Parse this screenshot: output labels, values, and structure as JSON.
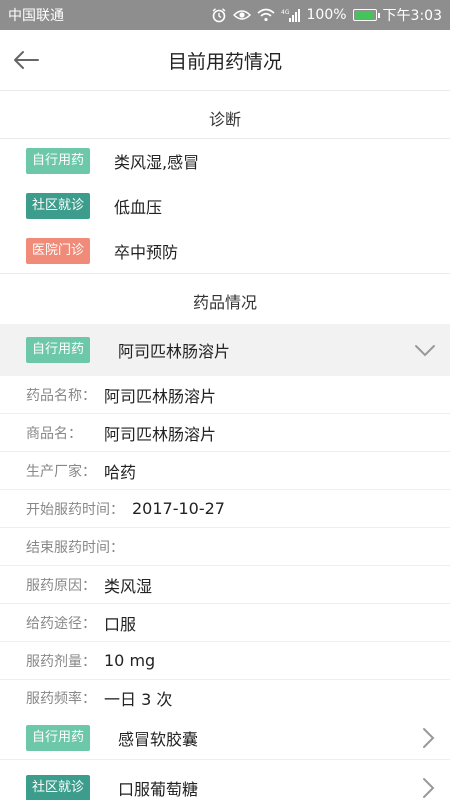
{
  "status_bar": {
    "carrier": "中国联通",
    "battery": "100%",
    "time": "下午3:03",
    "network": "4G",
    "battery_level": 1.0
  },
  "nav": {
    "title": "目前用药情况"
  },
  "diagnosis": {
    "title": "诊断",
    "items": [
      {
        "tag": "自行用药",
        "text": "类风湿,感冒"
      },
      {
        "tag": "社区就诊",
        "text": "低血压"
      },
      {
        "tag": "医院门诊",
        "text": "卒中预防"
      }
    ]
  },
  "drugs": {
    "title": "药品情况",
    "expanded": {
      "tag": "自行用药",
      "name": "阿司匹林肠溶片",
      "details": [
        {
          "label": "药品名称：",
          "value": "阿司匹林肠溶片"
        },
        {
          "label": "商品名：",
          "value": "阿司匹林肠溶片"
        },
        {
          "label": "生产厂家：",
          "value": "哈药"
        },
        {
          "label": "开始服药时间：",
          "value": "2017-10-27"
        },
        {
          "label": "结束服药时间：",
          "value": ""
        },
        {
          "label": "服药原因：",
          "value": "类风湿"
        },
        {
          "label": "给药途径：",
          "value": "口服"
        },
        {
          "label": "服药剂量：",
          "value": "10 mg"
        },
        {
          "label": "服药频率：",
          "value": "一日 3 次"
        }
      ]
    },
    "list": [
      {
        "tag": "自行用药",
        "name": "感冒软胶囊"
      },
      {
        "tag": "社区就诊",
        "name": "口服葡萄糖"
      }
    ]
  },
  "colors": {
    "tag_self": "#6cc8a8",
    "tag_community": "#3c9d8c",
    "tag_hospital": "#ef8b78",
    "status_bar_bg": "#8e8e8e"
  }
}
